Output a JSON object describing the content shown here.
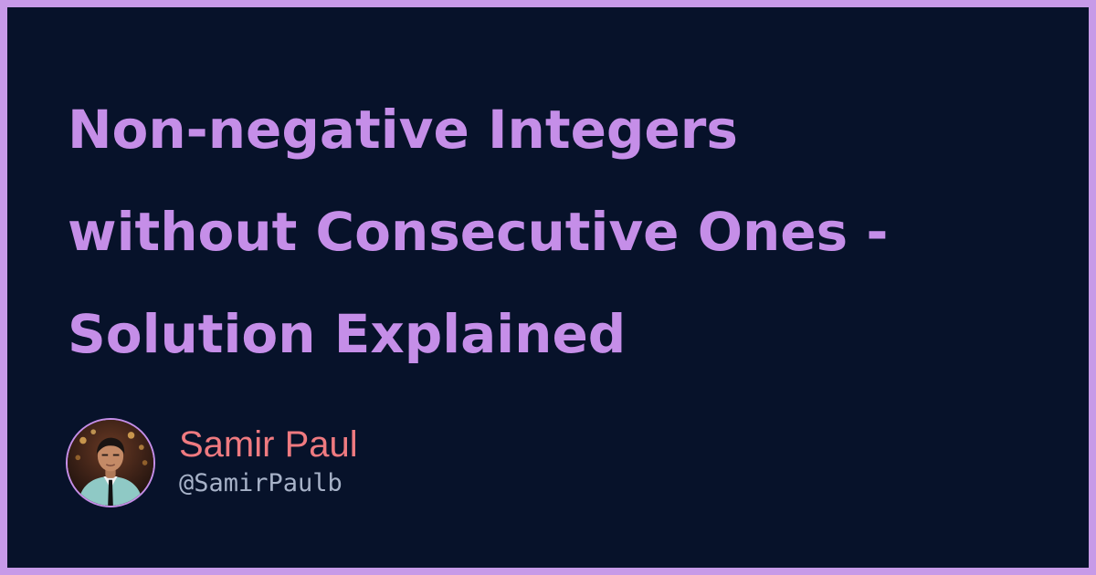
{
  "post": {
    "title_lines": [
      "Non-negative Integers",
      "without Consecutive Ones -",
      "Solution Explained"
    ]
  },
  "author": {
    "name": "Samir Paul",
    "handle": "@SamirPaulb",
    "avatar_icon": "person-photo-avatar"
  },
  "colors": {
    "frame": "#c79ae8",
    "background": "#07122a",
    "title": "#c58ee8",
    "name": "#ef7a80",
    "handle": "#a7b2c8"
  }
}
